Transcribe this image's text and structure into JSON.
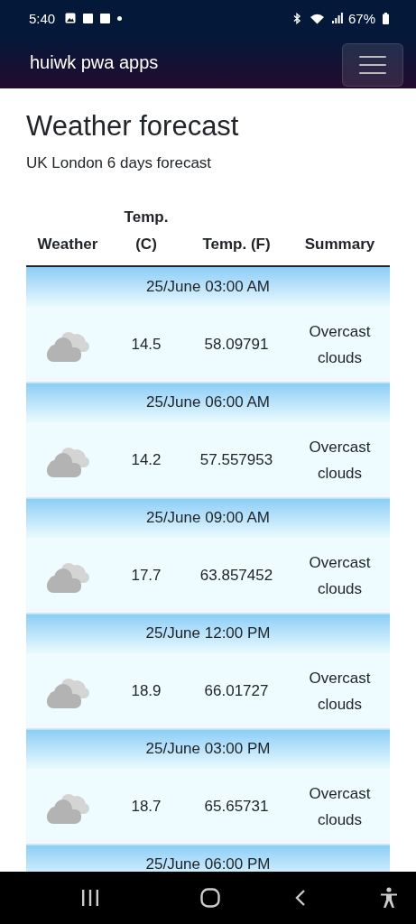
{
  "status_bar": {
    "time": "5:40",
    "battery": "67%"
  },
  "navbar": {
    "brand": "huiwk pwa apps"
  },
  "page": {
    "title": "Weather forecast",
    "subtitle": "UK London 6 days forecast"
  },
  "table": {
    "columns": [
      "Weather",
      "Temp. (C)",
      "Temp. (F)",
      "Summary"
    ],
    "rows": [
      {
        "datetime": "25/June 03:00 AM",
        "temp_c": "14.5",
        "temp_f": "58.09791",
        "summary": "Overcast clouds"
      },
      {
        "datetime": "25/June 06:00 AM",
        "temp_c": "14.2",
        "temp_f": "57.557953",
        "summary": "Overcast clouds"
      },
      {
        "datetime": "25/June 09:00 AM",
        "temp_c": "17.7",
        "temp_f": "63.857452",
        "summary": "Overcast clouds"
      },
      {
        "datetime": "25/June 12:00 PM",
        "temp_c": "18.9",
        "temp_f": "66.01727",
        "summary": "Overcast clouds"
      },
      {
        "datetime": "25/June 03:00 PM",
        "temp_c": "18.7",
        "temp_f": "65.65731",
        "summary": "Overcast clouds"
      },
      {
        "datetime": "25/June 06:00 PM"
      }
    ]
  }
}
